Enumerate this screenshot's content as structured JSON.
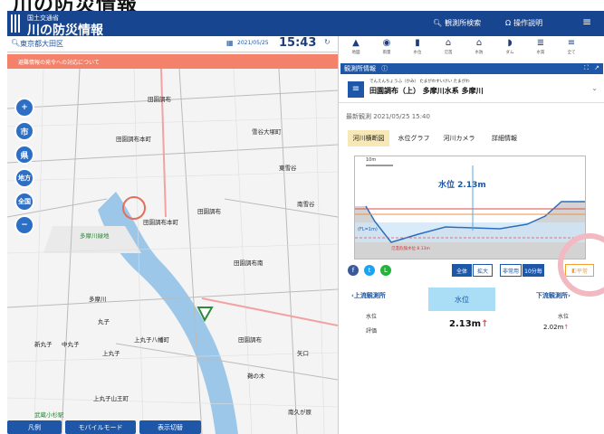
{
  "banner_text": "川の防災情報",
  "header": {
    "org": "国土交通省",
    "title": "川の防災情報",
    "search_label": "観測所検索",
    "settings_label": "操作説明"
  },
  "map": {
    "location": "東京都大田区",
    "date": "2021/05/25",
    "time": "15:43",
    "alert": "避難情報の発令への対応について",
    "zoom_buttons": [
      "市",
      "県",
      "地方",
      "全国"
    ],
    "labels": [
      "田園調布",
      "田園調布本町",
      "多摩川緑地",
      "田園調布",
      "田園調布本町",
      "田園調布南",
      "多摩川",
      "丸子",
      "上丸子",
      "上丸子八幡町",
      "上丸子山王町",
      "新丸子",
      "中丸子",
      "武蔵小杉駅",
      "雪谷大塚町",
      "東雪谷",
      "南雪谷",
      "田園調布",
      "鵜の木",
      "矢口",
      "南久が原"
    ],
    "bottom_buttons": [
      "凡例",
      "モバイルモード",
      "表示切替"
    ]
  },
  "panel": {
    "toolbar": [
      {
        "icon": "▲",
        "label": "地図"
      },
      {
        "icon": "◉",
        "label": "雨量"
      },
      {
        "icon": "▮",
        "label": "水位"
      },
      {
        "icon": "⌂",
        "label": "氾濫"
      },
      {
        "icon": "⌂",
        "label": "水防"
      },
      {
        "icon": "◗",
        "label": "ダム"
      },
      {
        "icon": "≣",
        "label": "水質"
      },
      {
        "icon": "≡",
        "label": "全て"
      }
    ],
    "title": "観測所情報",
    "station_ruby": "でんえんちょうふ（かみ）  たまがわすいけい  たまがわ",
    "station_name": "田園調布（上）  多摩川水系 多摩川",
    "timestamp": "最新観測 2021/05/25 15:40",
    "tabs": [
      "河川横断図",
      "水位グラフ",
      "河川カメラ",
      "詳細情報"
    ],
    "graph": {
      "scale_label": "10m",
      "water_level_label": "水位 2.13m",
      "fl_label": "(FL=1m)",
      "dashed_label": "氾濫危険水位 8.13m"
    },
    "graph_buttons": [
      "全体",
      "拡大",
      "非常用",
      "10分毎",
      "平常"
    ],
    "upstream_label": "‹上流観測所",
    "downstream_label": "下流観測所›",
    "level_box": "水位",
    "rows": {
      "col1": [
        "水位",
        "評価"
      ],
      "current_value": "2.13m",
      "downstream_value": "2.02m",
      "downstream_label": "水位"
    }
  }
}
